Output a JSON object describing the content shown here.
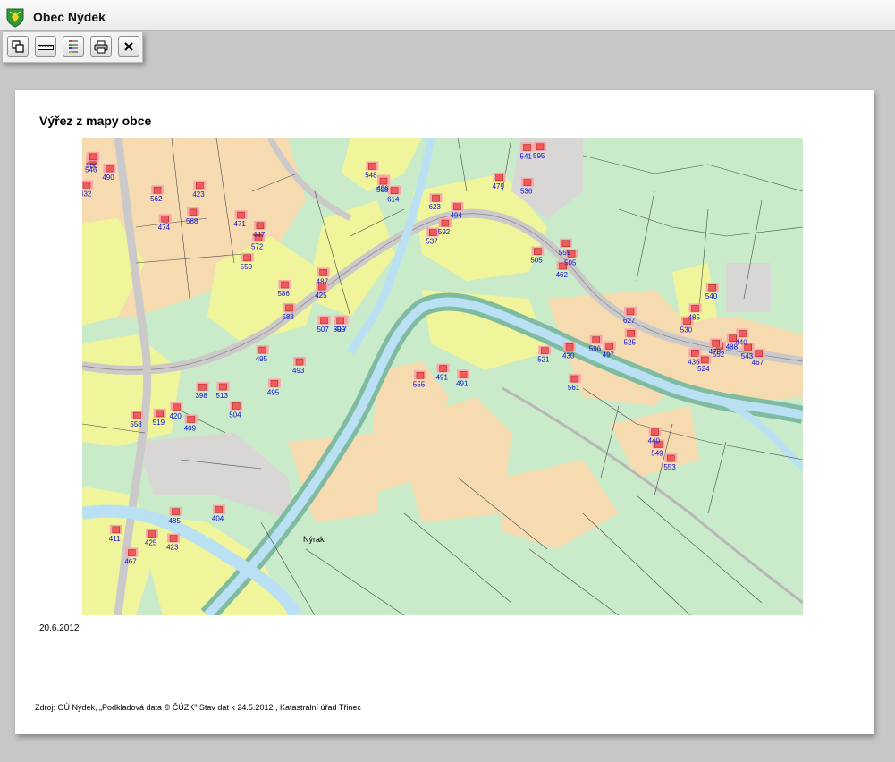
{
  "window": {
    "title": "Obec Nýdek"
  },
  "toolbar": {
    "buttons": [
      {
        "icon": "copy-window-icon"
      },
      {
        "icon": "ruler-icon"
      },
      {
        "icon": "legend-list-icon"
      },
      {
        "icon": "printer-icon"
      },
      {
        "icon": "close-icon"
      }
    ]
  },
  "page": {
    "heading": "Výřez z mapy obce",
    "date": "20.6.2012",
    "source": "Zdroj: OÚ Nýdek, „Podkladová data © ČÚZK\" Stav dat k 24.5.2012 , Katastrální úřad Třinec"
  },
  "map": {
    "place_label": "Nýrak",
    "parcel_numbers": [
      "490",
      "562",
      "572",
      "588",
      "496",
      "592",
      "595",
      "559",
      "627",
      "436",
      "440",
      "409",
      "398",
      "404",
      "467",
      "493",
      "555",
      "521",
      "549",
      "530",
      "427",
      "432",
      "474",
      "447",
      "425",
      "614",
      "623",
      "541",
      "505",
      "525",
      "552",
      "467",
      "519",
      "513",
      "485",
      "425",
      "495",
      "491",
      "561",
      "553",
      "540",
      "599",
      "546",
      "588",
      "550",
      "586",
      "508",
      "537",
      "536",
      "505",
      "596",
      "473",
      "488",
      "420",
      "504",
      "423",
      "411",
      "495",
      "491",
      "430",
      "440",
      "485",
      "507",
      "500",
      "423",
      "471",
      "487",
      "548",
      "494",
      "479",
      "462",
      "497",
      "524",
      "543",
      "558"
    ],
    "colors": {
      "forest": "#c9ebc9",
      "meadow": "#f0f49b",
      "field": "#f6dbb0",
      "built": "#d9d6d6",
      "water": "#b9e1f3",
      "river_bank": "#7fbba0",
      "road": "#cbc9c9",
      "building": "#f05a5a",
      "yard": "#f9a8a8",
      "parcel_label": "#1010d0"
    }
  }
}
